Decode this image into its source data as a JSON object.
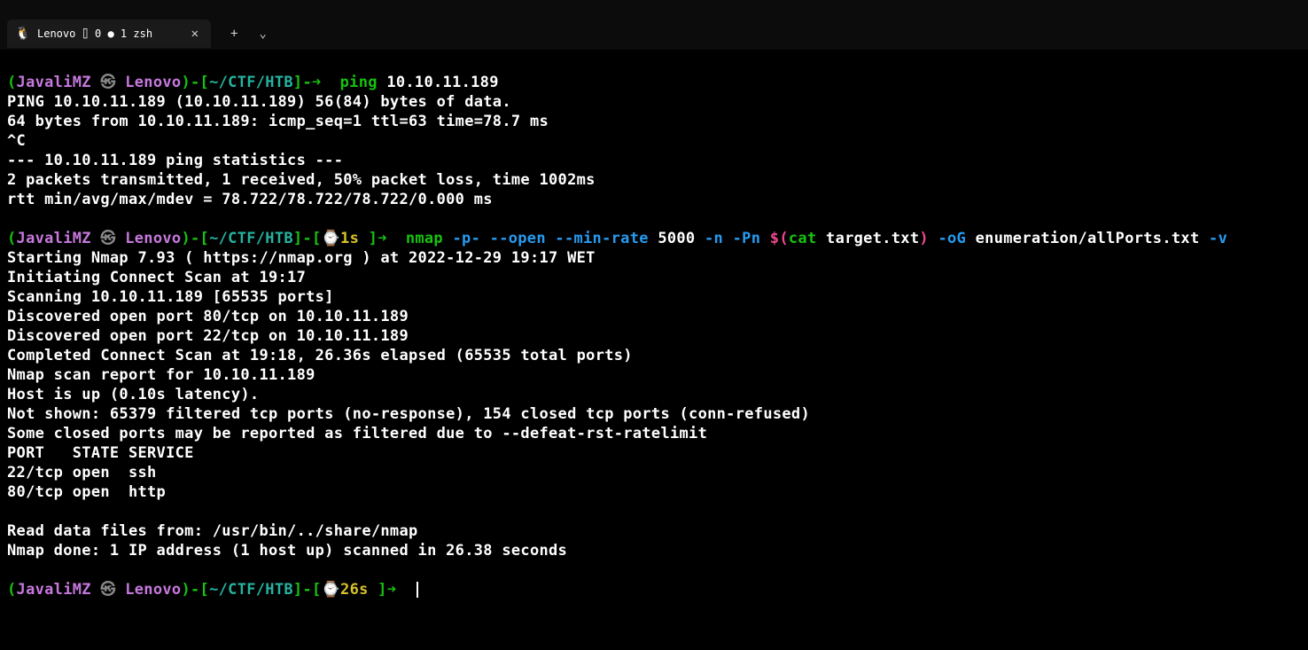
{
  "tab": {
    "title": "Lenovo ⌷ 0 ● 1 zsh",
    "icon": "🐧"
  },
  "controls": {
    "new_tab": "+",
    "dropdown": "⌄"
  },
  "prompt": {
    "open_paren": "(",
    "user": "JavaliMZ",
    "skull": "㉿",
    "host": "Lenovo",
    "close_paren": ")",
    "dash": "-",
    "open_bracket": "[",
    "path": "~/CTF/HTB",
    "close_bracket": "]",
    "arrow": "➜ ",
    "time1_open": "[",
    "time1_icon": "⌚",
    "time1_val": "1s ",
    "time1_close": "]",
    "time2_val": "26s "
  },
  "cmd1": {
    "command": "ping",
    "arg": "10.10.11.189"
  },
  "cmd2": {
    "command": "nmap",
    "arg_p": "-p-",
    "arg_open": "--open",
    "arg_minrate": "--min-rate",
    "val_5000": "5000",
    "arg_n": "-n",
    "arg_Pn": "-Pn",
    "subst_open": "$(",
    "subst_cat": "cat",
    "subst_file": "target.txt",
    "subst_close": ")",
    "arg_oG": "-oG",
    "val_output": "enumeration/allPorts.txt",
    "arg_v": "-v"
  },
  "output": {
    "ping_header": "PING 10.10.11.189 (10.10.11.189) 56(84) bytes of data.",
    "ping_reply": "64 bytes from 10.10.11.189: icmp_seq=1 ttl=63 time=78.7 ms",
    "ping_ctrlc": "^C",
    "ping_stats_hdr": "--- 10.10.11.189 ping statistics ---",
    "ping_stats_1": "2 packets transmitted, 1 received, 50% packet loss, time 1002ms",
    "ping_stats_2": "rtt min/avg/max/mdev = 78.722/78.722/78.722/0.000 ms",
    "nmap_l1": "Starting Nmap 7.93 ( https://nmap.org ) at 2022-12-29 19:17 WET",
    "nmap_l2": "Initiating Connect Scan at 19:17",
    "nmap_l3": "Scanning 10.10.11.189 [65535 ports]",
    "nmap_l4": "Discovered open port 80/tcp on 10.10.11.189",
    "nmap_l5": "Discovered open port 22/tcp on 10.10.11.189",
    "nmap_l6": "Completed Connect Scan at 19:18, 26.36s elapsed (65535 total ports)",
    "nmap_l7": "Nmap scan report for 10.10.11.189",
    "nmap_l8": "Host is up (0.10s latency).",
    "nmap_l9": "Not shown: 65379 filtered tcp ports (no-response), 154 closed tcp ports (conn-refused)",
    "nmap_l10": "Some closed ports may be reported as filtered due to --defeat-rst-ratelimit",
    "nmap_l11": "PORT   STATE SERVICE",
    "nmap_l12": "22/tcp open  ssh",
    "nmap_l13": "80/tcp open  http",
    "nmap_l14": "Read data files from: /usr/bin/../share/nmap",
    "nmap_l15": "Nmap done: 1 IP address (1 host up) scanned in 26.38 seconds"
  }
}
